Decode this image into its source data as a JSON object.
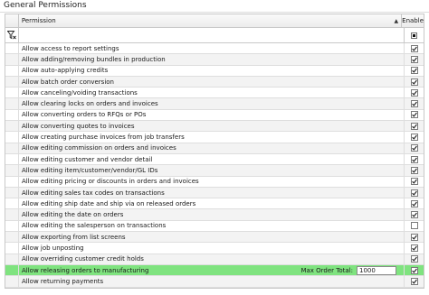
{
  "section": {
    "title": "General Permissions"
  },
  "grid": {
    "columns": {
      "permission": "Permission",
      "enable": "Enable"
    },
    "sort": "ascending",
    "filter_tristate": "indeterminate",
    "rows": [
      {
        "label": "Allow access to report settings",
        "checked": true
      },
      {
        "label": "Allow adding/removing bundles in production",
        "checked": true
      },
      {
        "label": "Allow auto-applying credits",
        "checked": true
      },
      {
        "label": "Allow batch order conversion",
        "checked": true
      },
      {
        "label": "Allow canceling/voiding transactions",
        "checked": true
      },
      {
        "label": "Allow clearing locks on orders and invoices",
        "checked": true
      },
      {
        "label": "Allow converting orders to RFQs or POs",
        "checked": true
      },
      {
        "label": "Allow converting quotes to invoices",
        "checked": true
      },
      {
        "label": "Allow creating purchase invoices from job transfers",
        "checked": true
      },
      {
        "label": "Allow editing commission on orders and invoices",
        "checked": true
      },
      {
        "label": "Allow editing customer and vendor detail",
        "checked": true
      },
      {
        "label": "Allow editing item/customer/vendor/GL IDs",
        "checked": true
      },
      {
        "label": "Allow editing pricing or discounts in orders and invoices",
        "checked": true
      },
      {
        "label": "Allow editing sales tax codes on transactions",
        "checked": true
      },
      {
        "label": "Allow editing ship date and ship via on released orders",
        "checked": true
      },
      {
        "label": "Allow editing the date on orders",
        "checked": true
      },
      {
        "label": "Allow editing the salesperson on transactions",
        "checked": false
      },
      {
        "label": "Allow exporting from list screens",
        "checked": true
      },
      {
        "label": "Allow job unposting",
        "checked": true
      },
      {
        "label": "Allow overriding customer credit holds",
        "checked": true
      },
      {
        "label": "Allow releasing orders to manufacturing",
        "checked": true,
        "selected": true,
        "extra_label": "Max Order Total:",
        "extra_value": "1000"
      },
      {
        "label": "Allow returning payments",
        "checked": true
      }
    ]
  },
  "colors": {
    "selected_row": "#7fe37f",
    "alt_row": "#f3f3f3"
  },
  "icons": {
    "filter": "filter-clear-icon",
    "sort": "sort-up-icon",
    "check": "checkmark-icon"
  }
}
